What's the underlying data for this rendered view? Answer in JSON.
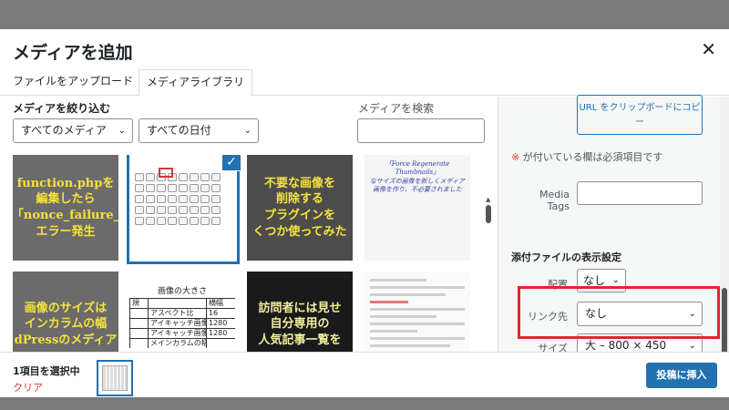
{
  "modal": {
    "title": "メディアを追加",
    "close_icon": "close-icon"
  },
  "tabs": [
    {
      "label": "ファイルをアップロード",
      "active": false
    },
    {
      "label": "メディアライブラリ",
      "active": true
    }
  ],
  "toolbar": {
    "filter_label": "メディアを絞り込む",
    "type_filter": "すべてのメディア",
    "date_filter": "すべての日付",
    "search_label": "メディアを検索",
    "search_value": ""
  },
  "thumbnails": [
    {
      "caption": "function.phpを\n編集したら\n「nonce_failure_\nエラー発生",
      "selected": false
    },
    {
      "caption": "",
      "selected": true
    },
    {
      "caption": "不要な画像を\n削除する\nプラグインを\nくつか使ってみた",
      "selected": false
    },
    {
      "caption": "「Force Regenerate Thumbnails」\nなサイズの画像を新しくメディア\n画像を作り、不必要されました",
      "selected": false
    },
    {
      "caption": "画像のサイズは\nインカラムの幅\ndPressのメディア",
      "selected": false
    },
    {
      "caption": "",
      "selected": false
    },
    {
      "caption": "訪問者には見せ\n自分専用の\n人気記事一覧を",
      "selected": false
    },
    {
      "caption": "",
      "selected": false
    }
  ],
  "table_image": {
    "title": "画像の大きさ",
    "header": "横幅",
    "side": "規",
    "rows": [
      {
        "label": "アスペクト比",
        "value": "16"
      },
      {
        "label": "アイキャッチ画像",
        "value": "1280"
      },
      {
        "label": "アイキャッチ画像",
        "value": "1280"
      },
      {
        "label": "メインカラムの幅",
        "value": ""
      }
    ]
  },
  "sidebar": {
    "copy_button": "URL をクリップボードにコピー",
    "required_mark": "※",
    "required_note": "が付いている欄は必須項目です",
    "media_tags_label": "Media Tags",
    "media_tags_value": "",
    "display_settings_title": "添付ファイルの表示設定",
    "align_label": "配置",
    "align_value": "なし",
    "link_label": "リンク先",
    "link_value": "なし",
    "size_label": "サイズ",
    "size_value": "大 – 800 × 450"
  },
  "footer": {
    "selected_count": "1項目を選択中",
    "clear_link": "クリア",
    "insert_button": "投稿に挿入"
  },
  "colors": {
    "accent": "#2271b1",
    "highlight": "#e0262f",
    "clear": "#d63638"
  }
}
